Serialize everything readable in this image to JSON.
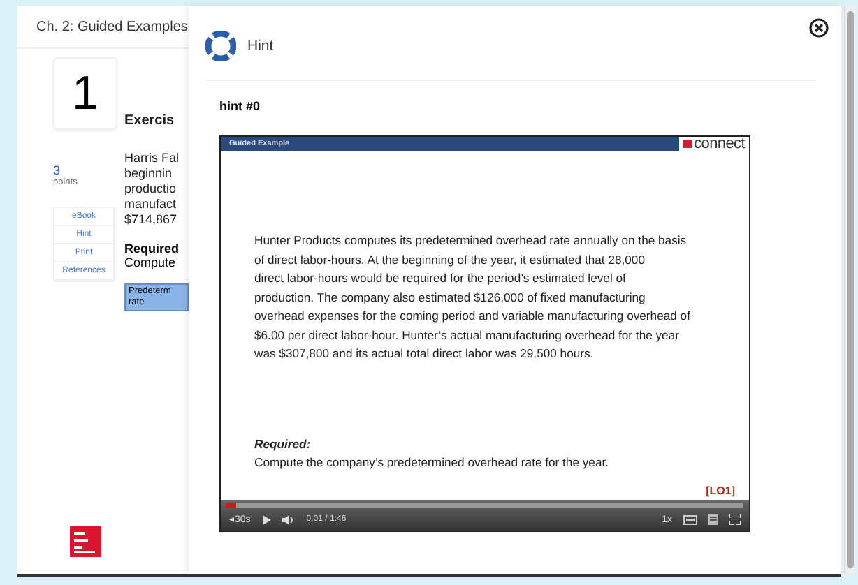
{
  "page": {
    "title": "Ch. 2: Guided Examples",
    "question_number": "1",
    "exercise_title": "Exercis",
    "points": "3",
    "points_label": "points",
    "tools": [
      {
        "label": "eBook"
      },
      {
        "label": "Hint"
      },
      {
        "label": "Print"
      },
      {
        "label": "References"
      }
    ],
    "body_lines": [
      "Harris Fal",
      "beginnin",
      "productio",
      "manufact",
      "$714,867"
    ],
    "required_label": "Required",
    "required_text": "Compute",
    "answer_cell_lines": [
      "Predeterm",
      "rate"
    ]
  },
  "modal": {
    "title": "Hint",
    "hint_label": "hint #0",
    "video": {
      "banner": "Guided Example",
      "brand": "connect",
      "paragraph_lines": [
        "Hunter Products computes its predetermined overhead rate annually on the basis",
        "of direct labor-hours. At the beginning of the year, it estimated that 28,000",
        "direct labor-hours would be required for the period’s estimated level of",
        "production. The company also estimated $126,000 of fixed manufacturing",
        "overhead expenses for the coming period and variable manufacturing overhead of",
        "$6.00 per direct labor-hour. Hunter’s actual manufacturing overhead for the year",
        "was $307,800 and its actual total direct labor was 29,500 hours."
      ],
      "required_label": "Required:",
      "required_text": "Compute the company’s predetermined overhead rate for the year.",
      "tag": "[LO1]",
      "level": 0.02,
      "skip_label": "◂30s",
      "time": "0:01 / 1:46",
      "speed": "1x"
    }
  }
}
